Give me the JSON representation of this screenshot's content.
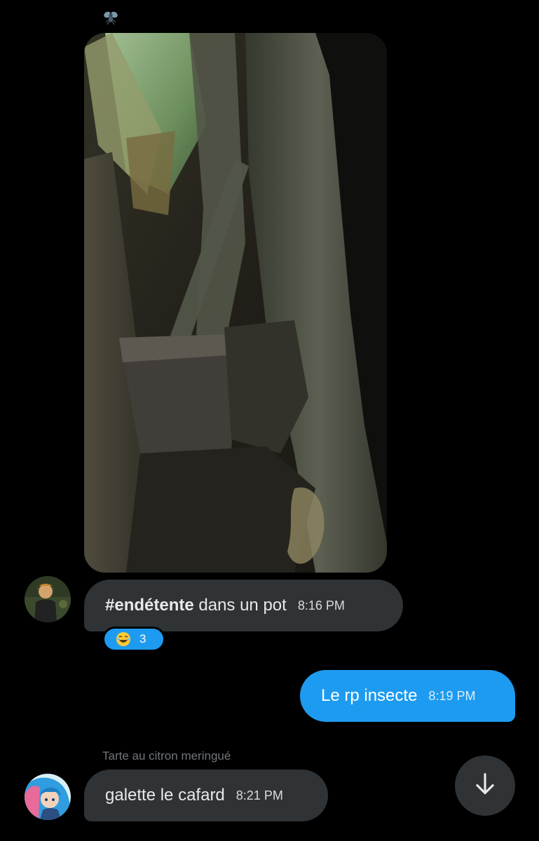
{
  "conversation": {
    "messages": [
      {
        "type": "image",
        "alt_icon": "fly-icon",
        "image": "photo-plant-pot"
      },
      {
        "type": "received",
        "avatar": "avatar-user-1",
        "hashtag": "#endétente",
        "text": " dans un pot",
        "time": "8:16 PM",
        "reaction": {
          "emoji": "laughing-emoji-icon",
          "count": "3"
        }
      },
      {
        "type": "sent",
        "text": "Le rp insecte",
        "time": "8:19 PM"
      },
      {
        "type": "received",
        "sender": "Tarte au citron meringué",
        "avatar": "avatar-user-2",
        "text": "galette le cafard",
        "time": "8:21 PM"
      }
    ]
  },
  "scroll_button": {
    "icon": "arrow-down-icon"
  },
  "colors": {
    "background": "#000000",
    "received_bubble": "#2f3336",
    "sent_bubble": "#1d9bf0",
    "secondary_text": "#71767b"
  }
}
